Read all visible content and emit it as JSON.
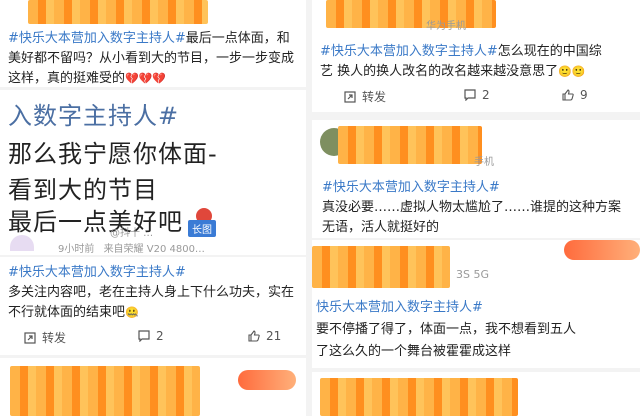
{
  "left_top": {
    "line1_tag": "#快乐大本营加入数字主持人#",
    "line1_text": "最后一点体面，和",
    "line2": "美好都不留吗？从小看到大的节目，一步一步变成",
    "line3": "这样，真的挺难受的",
    "emoji": "💔💔💔"
  },
  "left_image": {
    "line1": "入数字主持人#",
    "line2": "那么我宁愿你体面-",
    "line3": "看到大的节目",
    "line4": "最后一点美好吧",
    "badge": "长图",
    "watermark": "@抖十 …",
    "time": "9小时前",
    "source": "来自荣耀 V20 4800…"
  },
  "left_bottom": {
    "tag": "#快乐大本营加入数字主持人#",
    "line2": "多关注内容吧，老在主持人身上下什么功夫，实在",
    "line3": "不行就体面的结束吧",
    "emoji": "🤐",
    "repost": "转发",
    "comments": "2",
    "likes": "21"
  },
  "right_top": {
    "device": "华为手机",
    "tag": "#快乐大本营加入数字主持人#",
    "line1_text": "怎么现在的中国综",
    "line2": "艺 换人的换人改名的改名越来越没意思了",
    "emoji": "🙂🙂",
    "repost": "转发",
    "comments": "2",
    "likes": "9"
  },
  "right_mid": {
    "device": "手机",
    "tag": "#快乐大本营加入数字主持人#",
    "line2": "真没必要……虚拟人物太尴尬了……谁提的这种方案",
    "line3": "无语，活人就挺好的"
  },
  "right_bottom": {
    "device": "3S 5G",
    "tag": "快乐大本营加入数字主持人#",
    "line2": "要不停播了得了，体面一点，我不想看到五人",
    "line3": "了这么久的一个舞台被霍霍成这样"
  }
}
